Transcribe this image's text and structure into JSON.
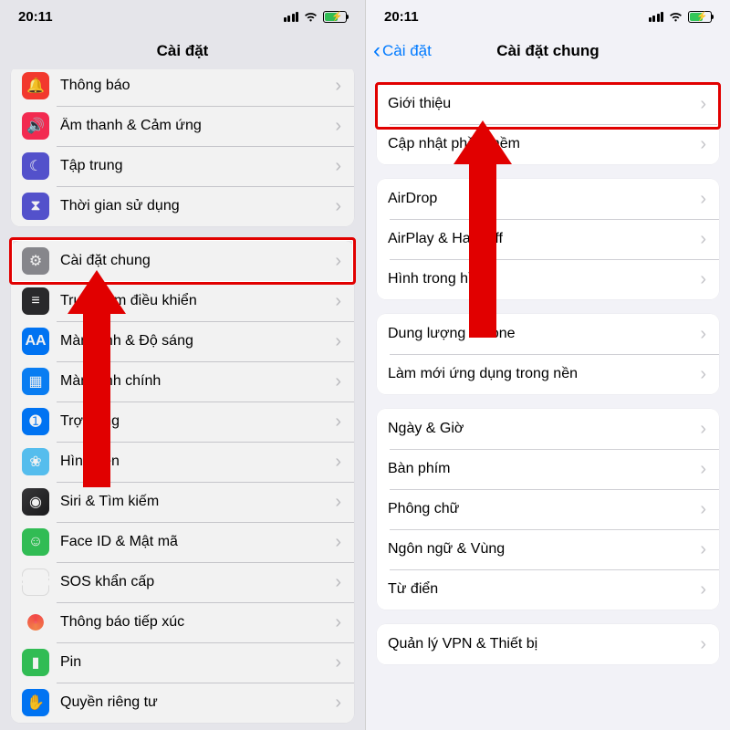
{
  "status": {
    "time": "20:11"
  },
  "left": {
    "title": "Cài đặt",
    "groups": [
      {
        "id": "g1",
        "noicon": false,
        "items": [
          {
            "label": "Thông báo",
            "icon": "bell",
            "bg": "bg-red"
          },
          {
            "label": "Âm thanh & Cảm ứng",
            "icon": "speaker",
            "bg": "bg-redS"
          },
          {
            "label": "Tập trung",
            "icon": "moon",
            "bg": "bg-indigo"
          },
          {
            "label": "Thời gian sử dụng",
            "icon": "hourglass",
            "bg": "bg-indigo"
          }
        ]
      },
      {
        "id": "g2",
        "noicon": false,
        "items": [
          {
            "label": "Cài đặt chung",
            "icon": "gear",
            "bg": "bg-gray",
            "highlight": true
          },
          {
            "label": "Trung tâm điều khiển",
            "icon": "switches",
            "bg": "bg-sw"
          },
          {
            "label": "Màn hình & Độ sáng",
            "icon": "AA",
            "bg": "bg-aa"
          },
          {
            "label": "Màn hình chính",
            "icon": "grid",
            "bg": "bg-blueD"
          },
          {
            "label": "Trợ năng",
            "icon": "person",
            "bg": "bg-blue"
          },
          {
            "label": "Hình nền",
            "icon": "flower",
            "bg": "bg-teal"
          },
          {
            "label": "Siri & Tìm kiếm",
            "icon": "siri",
            "bg": "bg-siri"
          },
          {
            "label": "Face ID & Mật mã",
            "icon": "face",
            "bg": "bg-green"
          },
          {
            "label": "SOS khẩn cấp",
            "icon": "SOS",
            "bg": "bg-sos"
          },
          {
            "label": "Thông báo tiếp xúc",
            "icon": "expo",
            "bg": "bg-expo"
          },
          {
            "label": "Pin",
            "icon": "battery",
            "bg": "bg-green"
          },
          {
            "label": "Quyền riêng tư",
            "icon": "hand",
            "bg": "bg-blue"
          }
        ]
      }
    ]
  },
  "right": {
    "back": "Cài đặt",
    "title": "Cài đặt chung",
    "groups": [
      {
        "id": "r1",
        "noicon": true,
        "items": [
          {
            "label": "Giới thiệu",
            "highlight": true
          },
          {
            "label": "Cập nhật phần mềm"
          }
        ]
      },
      {
        "id": "r2",
        "noicon": true,
        "items": [
          {
            "label": "AirDrop"
          },
          {
            "label": "AirPlay & Handoff"
          },
          {
            "label": "Hình trong hình"
          }
        ]
      },
      {
        "id": "r3",
        "noicon": true,
        "items": [
          {
            "label": "Dung lượng iPhone"
          },
          {
            "label": "Làm mới ứng dụng trong nền"
          }
        ]
      },
      {
        "id": "r4",
        "noicon": true,
        "items": [
          {
            "label": "Ngày & Giờ"
          },
          {
            "label": "Bàn phím"
          },
          {
            "label": "Phông chữ"
          },
          {
            "label": "Ngôn ngữ & Vùng"
          },
          {
            "label": "Từ điển"
          }
        ]
      },
      {
        "id": "r5",
        "noicon": true,
        "items": [
          {
            "label": "Quản lý VPN & Thiết bị"
          }
        ]
      }
    ]
  }
}
